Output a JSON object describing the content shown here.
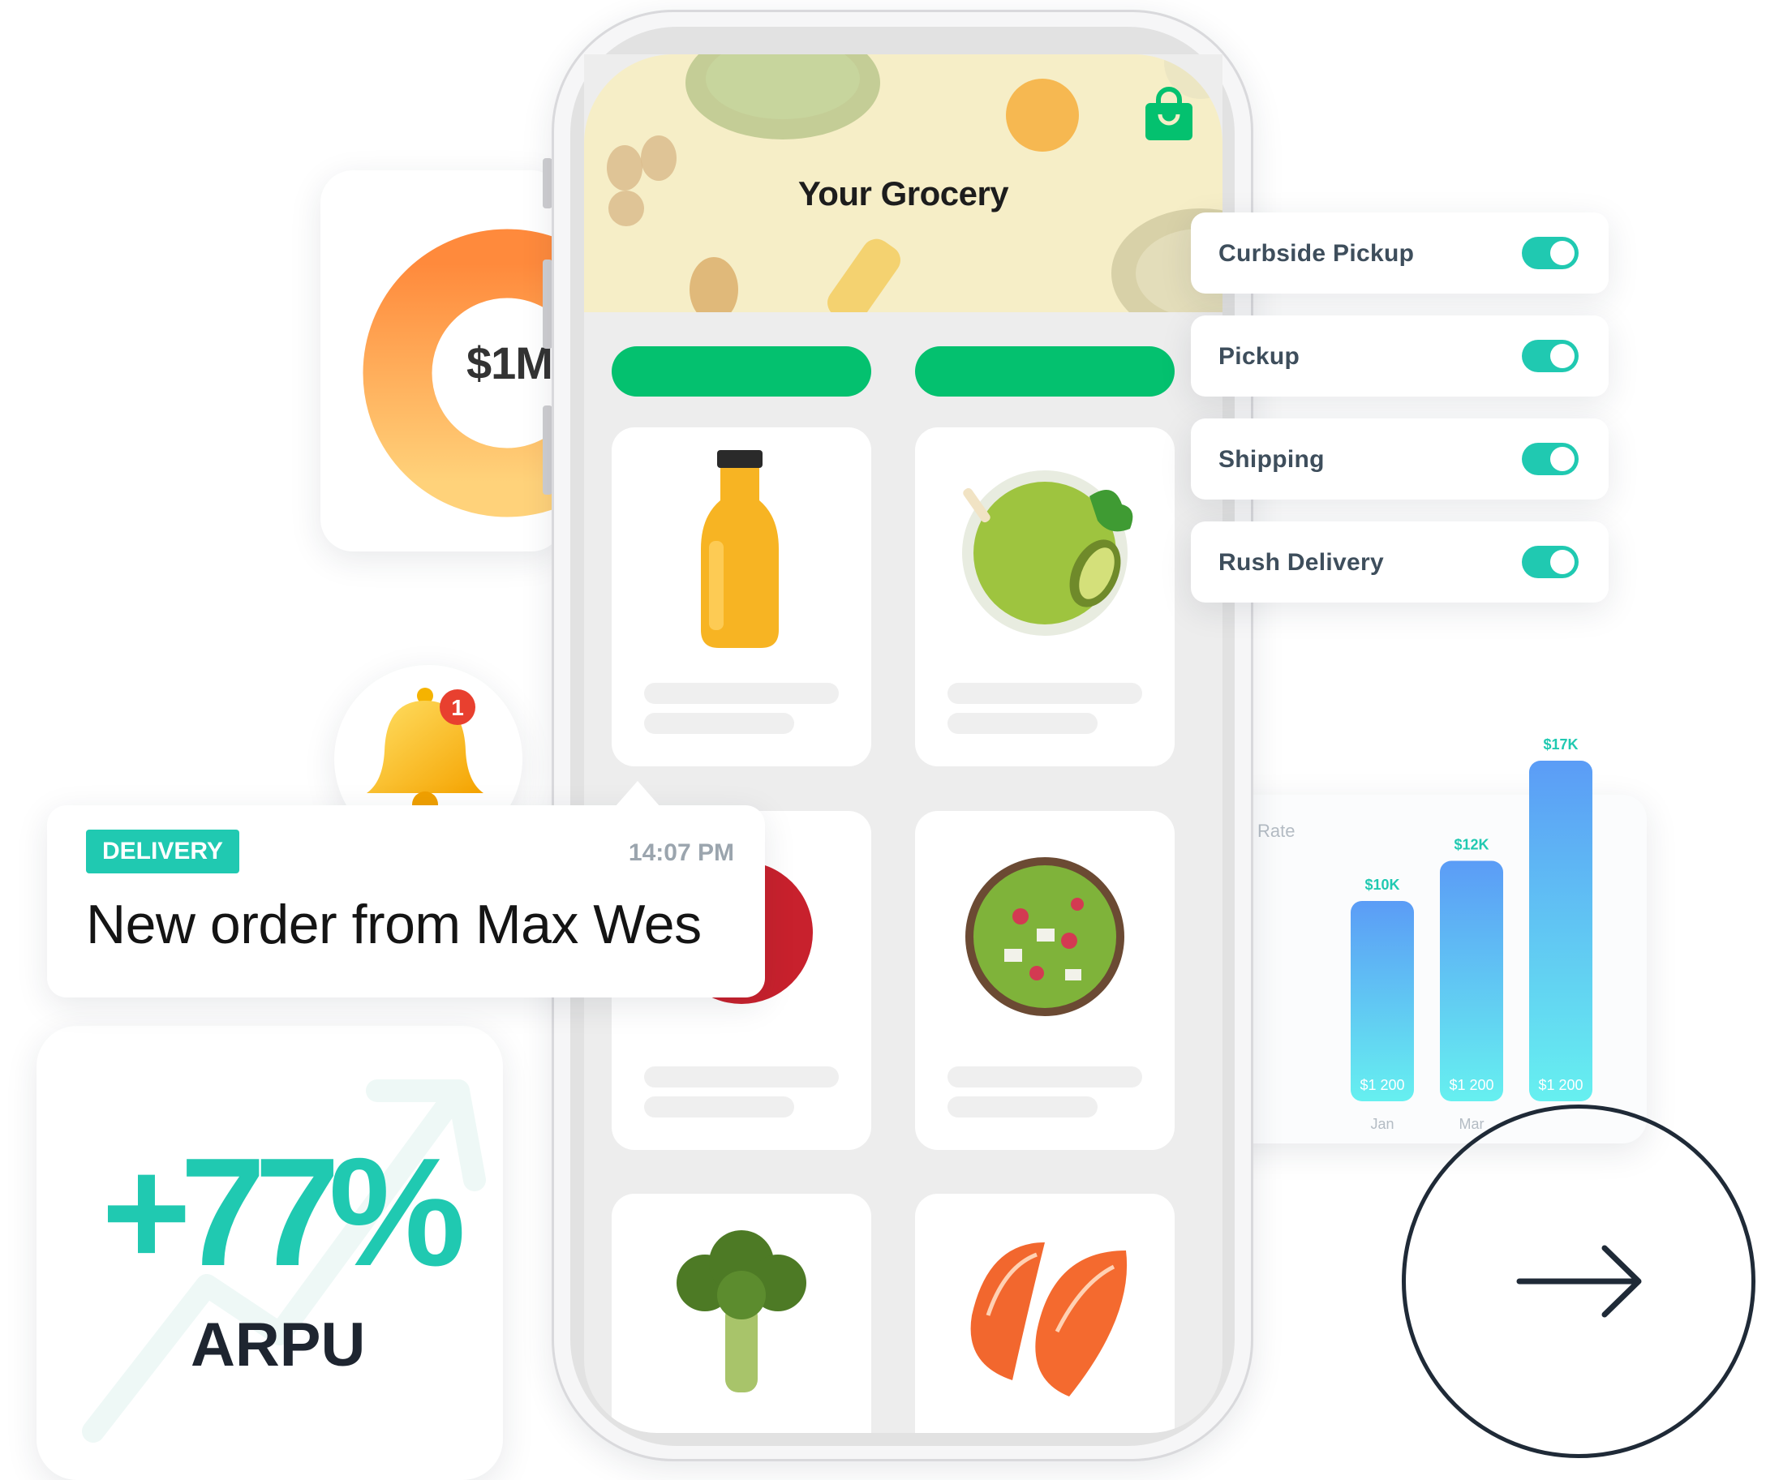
{
  "colors": {
    "brand_green": "#04c16f",
    "teal": "#20c9b1",
    "donut_start": "#ff8a3c",
    "donut_end": "#ffd27a",
    "bar_top": "#5b9cf6",
    "bar_bottom": "#66f0f0"
  },
  "revenue_donut": {
    "value": "$1M"
  },
  "arpu": {
    "value": "+77%",
    "label": "ARPU",
    "icon": "trend-up-arrow-icon"
  },
  "phone": {
    "title": "Your Grocery",
    "cart_icon": "shopping-bag-icon",
    "products": [
      {
        "name": "orange-juice-bottle",
        "icon": "juice-bottle-icon"
      },
      {
        "name": "green-smoothie",
        "icon": "smoothie-glass-icon"
      },
      {
        "name": "red-apple",
        "icon": "apple-icon"
      },
      {
        "name": "salad-bowl",
        "icon": "salad-bowl-icon"
      },
      {
        "name": "broccoli",
        "icon": "broccoli-icon"
      },
      {
        "name": "salmon-steaks",
        "icon": "salmon-icon"
      }
    ]
  },
  "delivery_options": [
    {
      "label": "Curbside Pickup",
      "enabled": true
    },
    {
      "label": "Pickup",
      "enabled": true
    },
    {
      "label": "Shipping",
      "enabled": true
    },
    {
      "label": "Rush Delivery",
      "enabled": true
    }
  ],
  "notification": {
    "badge": "DELIVERY",
    "time": "14:07 PM",
    "message": "New order from Max Wes",
    "bell_count": "1",
    "bell_icon": "bell-icon"
  },
  "chart_data": {
    "type": "bar",
    "title": "Rate",
    "categories": [
      "Jan",
      "Mar",
      ""
    ],
    "values": [
      10,
      12,
      17
    ],
    "top_labels": [
      "$10K",
      "$12K",
      "$17K"
    ],
    "bottom_labels": [
      "$1 200",
      "$1 200",
      "$1 200"
    ]
  },
  "next_button": {
    "icon": "arrow-right-icon"
  }
}
